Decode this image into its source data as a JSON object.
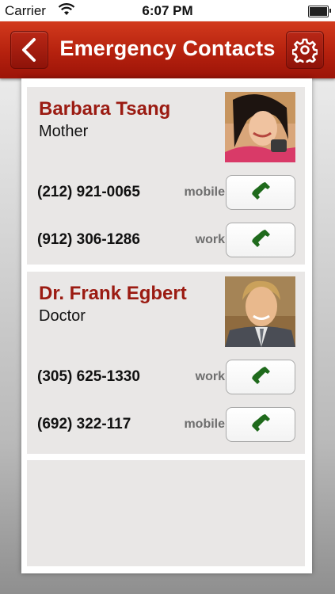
{
  "status_bar": {
    "carrier": "Carrier",
    "time": "6:07 PM"
  },
  "header": {
    "title": "Emergency Contacts",
    "back_icon": "chevron-left-icon",
    "settings_icon": "gear-icon"
  },
  "colors": {
    "brand_red": "#b5210e",
    "name_red": "#9b1b12",
    "call_green": "#1f6a1c"
  },
  "contacts": [
    {
      "name": "Barbara Tsang",
      "relation": "Mother",
      "phones": [
        {
          "number": "(212) 921-0065",
          "type": "mobile"
        },
        {
          "number": "(912) 306-1286",
          "type": "work"
        }
      ]
    },
    {
      "name": "Dr. Frank Egbert",
      "relation": "Doctor",
      "phones": [
        {
          "number": "(305) 625-1330",
          "type": "work"
        },
        {
          "number": "(692) 322-117",
          "type": "mobile"
        }
      ]
    }
  ]
}
